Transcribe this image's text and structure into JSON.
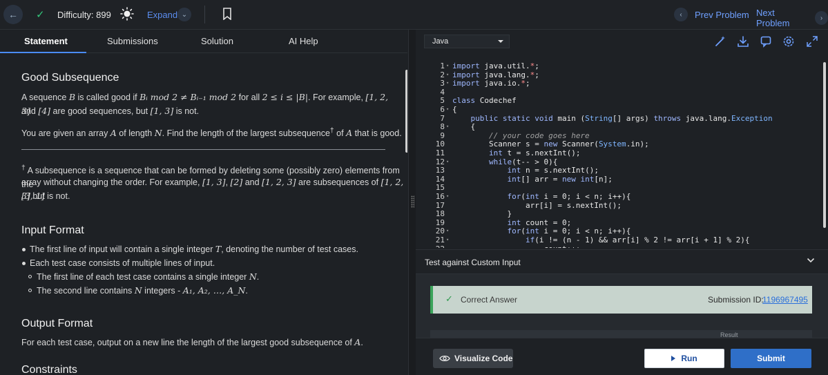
{
  "header": {
    "difficulty": "Difficulty: 899",
    "expand_label": "Expand",
    "prev_label": "Prev Problem",
    "next_label": "Next Problem",
    "accent": "#5b8def",
    "check_color": "#34c77b"
  },
  "tabs": [
    {
      "label": "Statement",
      "active": true
    },
    {
      "label": "Submissions",
      "active": false
    },
    {
      "label": "Solution",
      "active": false
    },
    {
      "label": "AI Help",
      "active": false
    }
  ],
  "problem": {
    "title": "Good Subsequence",
    "def_a": "A sequence ",
    "def_b": "B",
    "def_c": " is called good if ",
    "def_formula": "Bᵢ mod 2 ≠ Bᵢ₋₁ mod 2",
    "def_d": " for all ",
    "def_range": "2 ≤ i ≤ |B|",
    "def_e": ". For example, ",
    "def_ex1": "[1, 2, 3]",
    "def_line2_a": "and ",
    "def_ex2": "[4]",
    "def_line2_b": " are good sequences, but ",
    "def_ex3": "[1, 3]",
    "def_line2_c": " is not.",
    "task_a": "You are given an array ",
    "task_A": "A",
    "task_b": " of length ",
    "task_N": "N",
    "task_c": ". Find the length of the largest subsequence",
    "task_dagger": "†",
    "task_d": " of ",
    "task_A2": "A",
    "task_e": " that is good.",
    "note_dagger": "†",
    "note_line1": " A subsequence is a sequence that can be formed by deleting some (possibly zero) elements from the",
    "note_line2_a": "array without changing the order. For example, ",
    "note_ex1": "[1, 3]",
    "note_sep1": ", ",
    "note_ex2": "[2]",
    "note_sep2": " and ",
    "note_ex3": "[1, 2, 3]",
    "note_line2_b": " are subsequences of ",
    "note_ex4": "[1, 2, 3]",
    "note_line2_c": " but",
    "note_ex5": "[3, 1]",
    "note_line3": " is not.",
    "input_title": "Input Format",
    "input_1a": "The first line of input will contain a single integer ",
    "input_1T": "T",
    "input_1b": ", denoting the number of test cases.",
    "input_2": "Each test case consists of multiple lines of input.",
    "input_3a": "The first line of each test case contains a single integer ",
    "input_3N": "N",
    "input_3b": ".",
    "input_4a": "The second line contains ",
    "input_4N": "N",
    "input_4b": " integers - ",
    "input_4seq": "A₁, A₂, …, A_N",
    "input_4c": ".",
    "output_title": "Output Format",
    "output_a": "For each test case, output on a new line the length of the largest good subsequence of ",
    "output_A": "A",
    "output_b": ".",
    "constraints_title": "Constraints"
  },
  "editor": {
    "language": "Java",
    "lines": [
      {
        "n": "1",
        "fold": true,
        "html": "<span class='kw'>import</span> java.util.<span class='str'>*</span>;"
      },
      {
        "n": "2",
        "fold": true,
        "html": "<span class='kw'>import</span> java.lang.<span class='str'>*</span>;"
      },
      {
        "n": "3",
        "fold": true,
        "html": "<span class='kw'>import</span> java.io.<span class='str'>*</span>;"
      },
      {
        "n": "4",
        "fold": false,
        "html": ""
      },
      {
        "n": "5",
        "fold": false,
        "html": "<span class='kw'>class</span> Codechef"
      },
      {
        "n": "6",
        "fold": true,
        "html": "{"
      },
      {
        "n": "7",
        "fold": false,
        "html": "    <span class='kw'>public static void</span> main (<span class='cls'>String</span>[] args) <span class='kw'>throws</span> java.lang.<span class='cls'>Exception</span>"
      },
      {
        "n": "8",
        "fold": true,
        "html": "    {"
      },
      {
        "n": "9",
        "fold": false,
        "html": "        <span class='cm'>// your code goes here</span>"
      },
      {
        "n": "10",
        "fold": false,
        "html": "        Scanner s = <span class='kw'>new</span> Scanner(<span class='cls'>System</span>.in);"
      },
      {
        "n": "11",
        "fold": false,
        "html": "        <span class='kw'>int</span> t = s.nextInt();"
      },
      {
        "n": "12",
        "fold": true,
        "html": "        <span class='kw'>while</span>(t-- > 0){"
      },
      {
        "n": "13",
        "fold": false,
        "html": "            <span class='kw'>int</span> n = s.nextInt();"
      },
      {
        "n": "14",
        "fold": false,
        "html": "            <span class='kw'>int</span>[] arr = <span class='kw'>new int</span>[n];"
      },
      {
        "n": "15",
        "fold": false,
        "html": ""
      },
      {
        "n": "16",
        "fold": true,
        "html": "            <span class='kw'>for</span>(<span class='kw'>int</span> i = 0; i < n; i++){"
      },
      {
        "n": "17",
        "fold": false,
        "html": "                arr[i] = s.nextInt();"
      },
      {
        "n": "18",
        "fold": false,
        "html": "            }"
      },
      {
        "n": "19",
        "fold": false,
        "html": "            <span class='kw'>int</span> count = 0;"
      },
      {
        "n": "20",
        "fold": true,
        "html": "            <span class='kw'>for</span>(<span class='kw'>int</span> i = 0; i < n; i++){"
      },
      {
        "n": "21",
        "fold": true,
        "html": "                <span class='kw'>if</span>(i != (n - 1) && arr[i] % 2 != arr[i + 1] % 2){"
      },
      {
        "n": "22",
        "fold": false,
        "html": "                    count++;"
      }
    ]
  },
  "custom_input": {
    "label": "Test against Custom Input"
  },
  "result": {
    "status": "Correct Answer",
    "submission_label": "Submission ID:",
    "submission_id": "1196967495",
    "result_label": "Result",
    "success_color": "#3aa35a"
  },
  "actions": {
    "visualize_label": "Visualize Code",
    "run_label": "Run",
    "submit_label": "Submit"
  }
}
